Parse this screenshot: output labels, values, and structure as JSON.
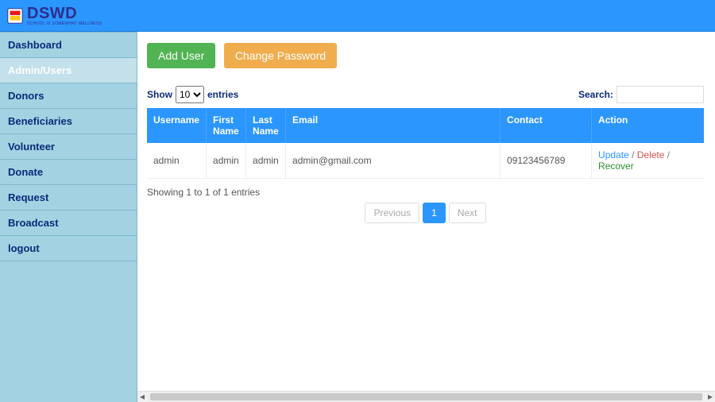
{
  "brand": {
    "name": "DSWD",
    "tagline": "SCHOOL IS SOMEWHAT WELLNESS"
  },
  "sidebar": {
    "items": [
      {
        "label": "Dashboard"
      },
      {
        "label": "Admin/Users"
      },
      {
        "label": "Donors"
      },
      {
        "label": "Beneficiaries"
      },
      {
        "label": "Volunteer"
      },
      {
        "label": "Donate"
      },
      {
        "label": "Request"
      },
      {
        "label": "Broadcast"
      },
      {
        "label": "logout"
      }
    ],
    "activeIndex": 1
  },
  "buttons": {
    "add_user": "Add User",
    "change_password": "Change Password"
  },
  "table": {
    "length_prefix": "Show",
    "length_suffix": "entries",
    "length_value": "10",
    "search_label": "Search:",
    "search_value": "",
    "headers": {
      "username": "Username",
      "first_name": "First Name",
      "last_name": "Last Name",
      "email": "Email",
      "contact": "Contact",
      "action": "Action"
    },
    "rows": [
      {
        "username": "admin",
        "first_name": "admin",
        "last_name": "admin",
        "email": "admin@gmail.com",
        "contact": "09123456789"
      }
    ],
    "actions": {
      "update": "Update",
      "delete": "Delete",
      "recover": "Recover"
    },
    "info": "Showing 1 to 1 of 1 entries",
    "pager": {
      "prev": "Previous",
      "pages": [
        "1"
      ],
      "next": "Next",
      "current": 0
    }
  }
}
